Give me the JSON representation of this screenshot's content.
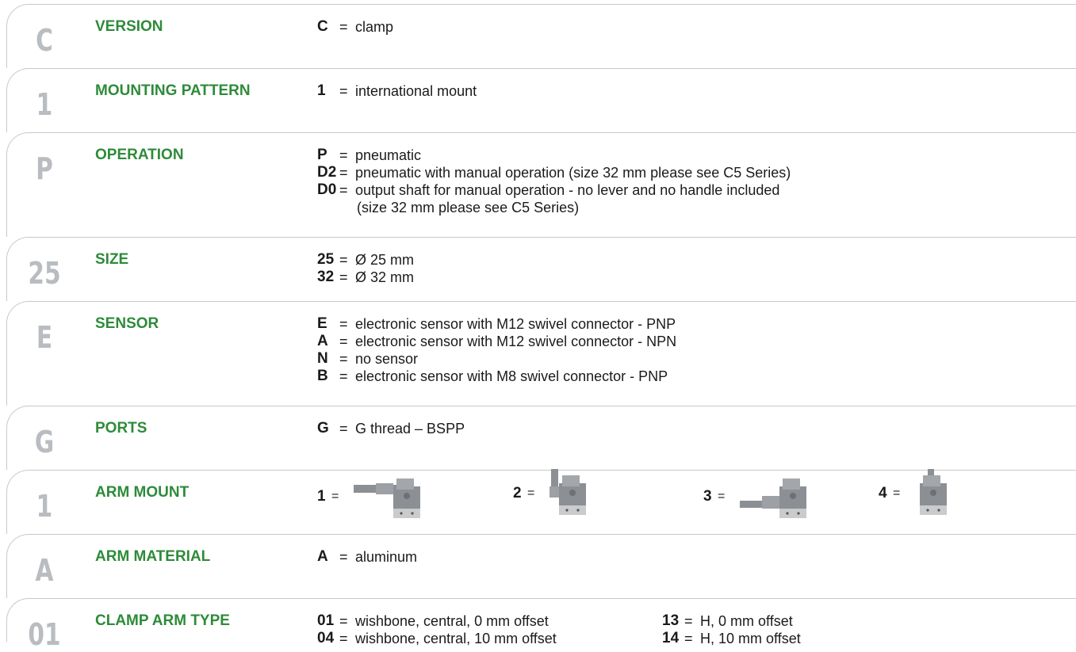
{
  "rows": [
    {
      "code": "C",
      "label": "VERSION",
      "options": [
        {
          "key": "C",
          "text": "clamp"
        }
      ]
    },
    {
      "code": "1",
      "label": "MOUNTING PATTERN",
      "options": [
        {
          "key": "1",
          "text": "international mount"
        }
      ]
    },
    {
      "code": "P",
      "label": "OPERATION",
      "options": [
        {
          "key": "P",
          "text": "pneumatic"
        },
        {
          "key": "D2",
          "text": "pneumatic with manual operation (size 32 mm please see C5 Series)"
        },
        {
          "key": "D0",
          "text": "output shaft for manual operation - no lever and no handle included",
          "continuation": "(size 32 mm please see C5 Series)"
        }
      ]
    },
    {
      "code": "25",
      "label": "SIZE",
      "options": [
        {
          "key": "25",
          "text": "Ø 25 mm"
        },
        {
          "key": "32",
          "text": "Ø 32 mm"
        }
      ]
    },
    {
      "code": "E",
      "label": "SENSOR",
      "options": [
        {
          "key": "E",
          "text": "electronic sensor with M12 swivel connector - PNP"
        },
        {
          "key": "A",
          "text": "electronic sensor with M12 swivel connector - NPN"
        },
        {
          "key": "N",
          "text": "no sensor"
        },
        {
          "key": "B",
          "text": "electronic sensor with M8 swivel connector - PNP"
        }
      ]
    },
    {
      "code": "G",
      "label": "PORTS",
      "options": [
        {
          "key": "G",
          "text": "G thread – BSPP"
        }
      ]
    },
    {
      "code": "1",
      "label": "ARM MOUNT",
      "arm_mounts": [
        {
          "key": "1",
          "image": "arm-mount-horizontal-left-icon"
        },
        {
          "key": "2",
          "image": "arm-mount-vertical-up-left-icon"
        },
        {
          "key": "3",
          "image": "arm-mount-horizontal-low-left-icon"
        },
        {
          "key": "4",
          "image": "arm-mount-vertical-up-icon"
        }
      ]
    },
    {
      "code": "A",
      "label": "ARM MATERIAL",
      "options": [
        {
          "key": "A",
          "text": "aluminum"
        }
      ]
    },
    {
      "code": "01",
      "label": "CLAMP ARM TYPE",
      "options": [
        {
          "key": "01",
          "text": "wishbone, central, 0 mm offset"
        },
        {
          "key": "04",
          "text": "wishbone, central, 10 mm offset"
        }
      ],
      "options_col2": [
        {
          "key": "13",
          "text": "H, 0 mm offset"
        },
        {
          "key": "14",
          "text": "H, 10 mm offset"
        }
      ]
    }
  ],
  "equals_sign": "="
}
